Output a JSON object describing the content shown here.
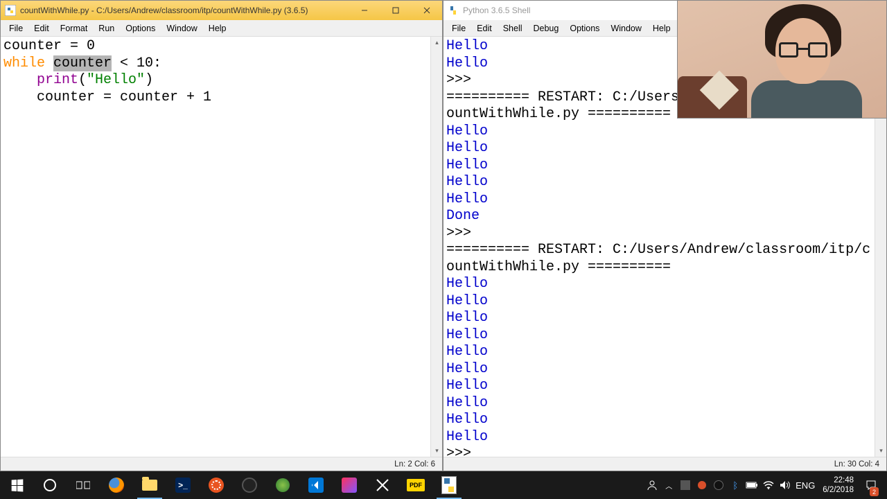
{
  "editor_window": {
    "title": "countWithWhile.py - C:/Users/Andrew/classroom/itp/countWithWhile.py (3.6.5)",
    "menus": [
      "File",
      "Edit",
      "Format",
      "Run",
      "Options",
      "Window",
      "Help"
    ],
    "status": "Ln: 2  Col: 6",
    "code": {
      "l1_a": "counter = 0",
      "l2_kw": "while",
      "l2_sp": " ",
      "l2_sel": "counter",
      "l2_rest": " < 10:",
      "l3_pad": "    ",
      "l3_fn": "print",
      "l3_open": "(",
      "l3_str": "\"Hello\"",
      "l3_close": ")",
      "l4": "    counter = counter + 1"
    }
  },
  "shell_window": {
    "title": "Python 3.6.5 Shell",
    "menus": [
      "File",
      "Edit",
      "Shell",
      "Debug",
      "Options",
      "Window",
      "Help"
    ],
    "status": "Ln: 30  Col: 4",
    "lines": [
      {
        "t": "Hello",
        "c": "blue"
      },
      {
        "t": "Hello",
        "c": "blue"
      },
      {
        "t": ">>> ",
        "c": "black"
      },
      {
        "t": "========== RESTART: C:/Users",
        "c": "black"
      },
      {
        "t": "ountWithWhile.py ==========",
        "c": "black"
      },
      {
        "t": "Hello",
        "c": "blue"
      },
      {
        "t": "Hello",
        "c": "blue"
      },
      {
        "t": "Hello",
        "c": "blue"
      },
      {
        "t": "Hello",
        "c": "blue"
      },
      {
        "t": "Hello",
        "c": "blue"
      },
      {
        "t": "Done",
        "c": "blue"
      },
      {
        "t": ">>> ",
        "c": "black"
      },
      {
        "t": "========== RESTART: C:/Users/Andrew/classroom/itp/c",
        "c": "black"
      },
      {
        "t": "ountWithWhile.py ==========",
        "c": "black"
      },
      {
        "t": "Hello",
        "c": "blue"
      },
      {
        "t": "Hello",
        "c": "blue"
      },
      {
        "t": "Hello",
        "c": "blue"
      },
      {
        "t": "Hello",
        "c": "blue"
      },
      {
        "t": "Hello",
        "c": "blue"
      },
      {
        "t": "Hello",
        "c": "blue"
      },
      {
        "t": "Hello",
        "c": "blue"
      },
      {
        "t": "Hello",
        "c": "blue"
      },
      {
        "t": "Hello",
        "c": "blue"
      },
      {
        "t": "Hello",
        "c": "blue"
      },
      {
        "t": ">>> ",
        "c": "black"
      }
    ]
  },
  "taskbar": {
    "time": "22:48",
    "date": "6/2/2018",
    "lang": "ENG",
    "notif_count": "2"
  }
}
